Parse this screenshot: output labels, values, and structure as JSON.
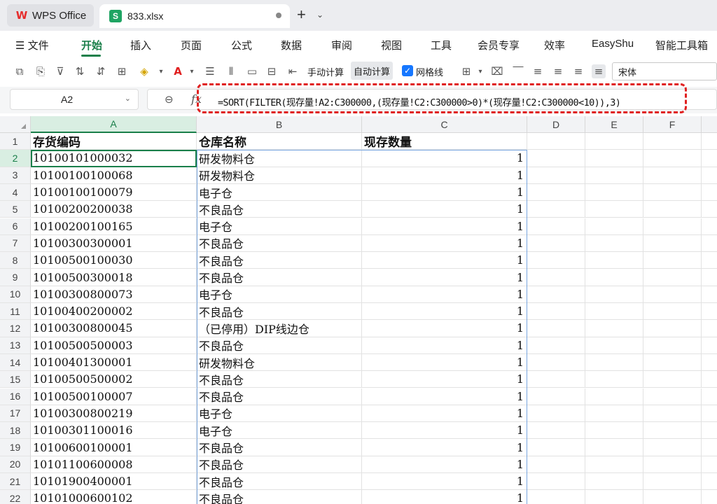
{
  "app": {
    "home_tab": "WPS Office",
    "file_tab": "833.xlsx",
    "file_icon_letter": "S",
    "new_tab": "+",
    "new_tab_chevron": "⌄"
  },
  "menu": {
    "hamburger": "☰ 文件",
    "items": [
      "开始",
      "插入",
      "页面",
      "公式",
      "数据",
      "审阅",
      "视图",
      "工具",
      "会员专享",
      "效率",
      "EasyShu",
      "智能工具箱"
    ],
    "active": "开始"
  },
  "toolbar": {
    "manual_calc": "手动计算",
    "auto_calc": "自动计算",
    "gridlines": "网格线",
    "font": "宋体",
    "icons": [
      "format-123-icon",
      "paste-format-icon",
      "filter-icon",
      "sort-asc-icon",
      "sort-desc-icon",
      "border-icon",
      "fill-color-icon",
      "font-color-icon",
      "wrap-icon",
      "column-icon",
      "freeze-icon",
      "table-icon",
      "merge-icon"
    ]
  },
  "formula_bar": {
    "name_box": "A2",
    "formula": "=SORT(FILTER(现存量!A2:C300000,(现存量!C2:C300000>0)*(现存量!C2:C300000<10)),3)"
  },
  "sheet": {
    "columns": [
      "A",
      "B",
      "C",
      "D",
      "E",
      "F"
    ],
    "header_row": [
      "存货编码",
      "仓库名称",
      "现存数量"
    ],
    "rows": [
      [
        "10100101000032",
        "研发物料仓",
        "1"
      ],
      [
        "10100100100068",
        "研发物料仓",
        "1"
      ],
      [
        "10100100100079",
        "电子仓",
        "1"
      ],
      [
        "10100200200038",
        "不良品仓",
        "1"
      ],
      [
        "10100200100165",
        "电子仓",
        "1"
      ],
      [
        "10100300300001",
        "不良品仓",
        "1"
      ],
      [
        "10100500100030",
        "不良品仓",
        "1"
      ],
      [
        "10100500300018",
        "不良品仓",
        "1"
      ],
      [
        "10100300800073",
        "电子仓",
        "1"
      ],
      [
        "10100400200002",
        "不良品仓",
        "1"
      ],
      [
        "10100300800045",
        "（已停用）DIP线边仓",
        "1"
      ],
      [
        "10100500500003",
        "不良品仓",
        "1"
      ],
      [
        "10100401300001",
        "研发物料仓",
        "1"
      ],
      [
        "10100500500002",
        "不良品仓",
        "1"
      ],
      [
        "10100500100007",
        "不良品仓",
        "1"
      ],
      [
        "10100300800219",
        "电子仓",
        "1"
      ],
      [
        "10100301100016",
        "电子仓",
        "1"
      ],
      [
        "10100600100001",
        "不良品仓",
        "1"
      ],
      [
        "10101100600008",
        "不良品仓",
        "1"
      ],
      [
        "10101900400001",
        "不良品仓",
        "1"
      ],
      [
        "10101000600102",
        "不良品仓",
        "1"
      ]
    ]
  }
}
